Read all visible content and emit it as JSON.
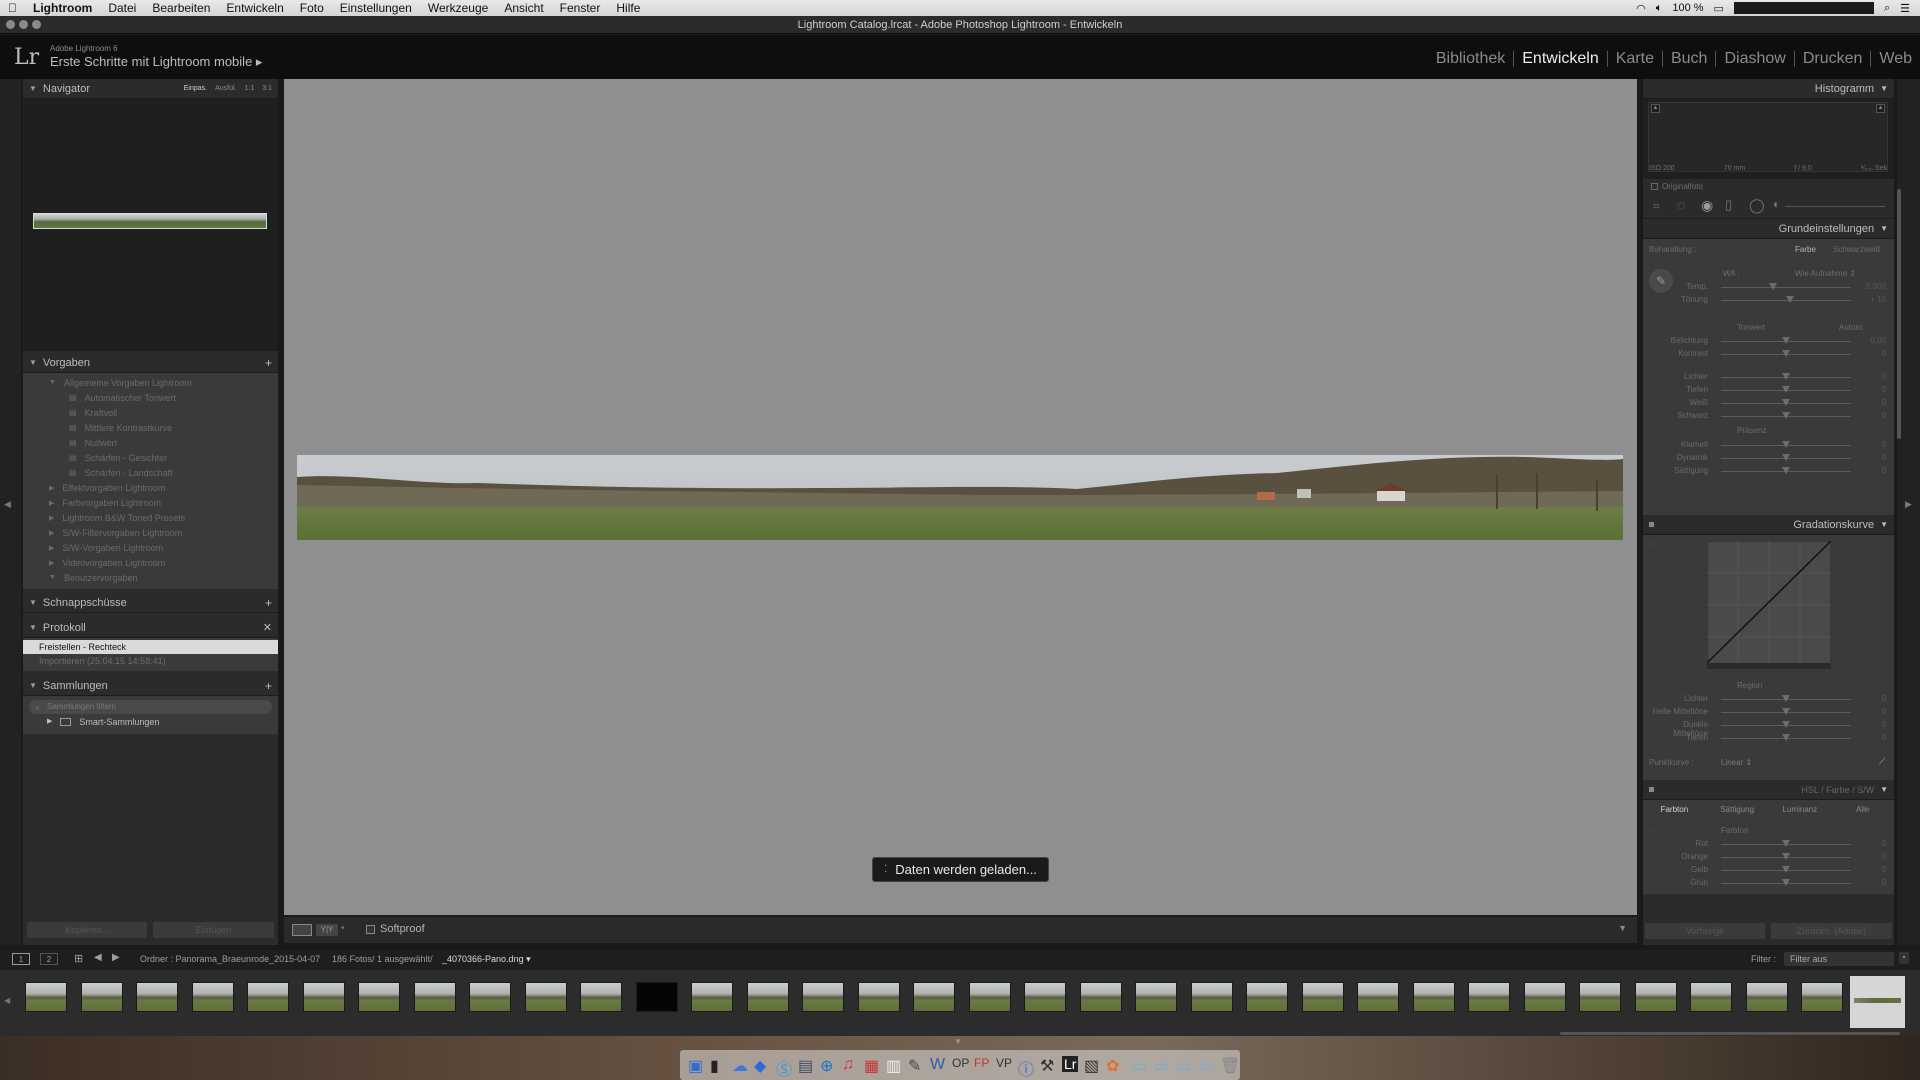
{
  "menubar": {
    "apple": "",
    "items": [
      "Lightroom",
      "Datei",
      "Bearbeiten",
      "Entwickeln",
      "Foto",
      "Einstellungen",
      "Werkzeuge",
      "Ansicht",
      "Fenster",
      "Hilfe"
    ],
    "battery": "100 %"
  },
  "window": {
    "title": "Lightroom Catalog.lrcat - Adobe Photoshop Lightroom - Entwickeln"
  },
  "identity": {
    "logo": "Lr",
    "version": "Adobe Lightroom 6",
    "plate": "Erste Schritte mit Lightroom mobile ▸"
  },
  "modules": [
    "Bibliothek",
    "Entwickeln",
    "Karte",
    "Buch",
    "Diashow",
    "Drucken",
    "Web"
  ],
  "navigator": {
    "title": "Navigator",
    "modes": [
      "Einpas.",
      "Ausfül.",
      "1:1",
      "3:1"
    ]
  },
  "presets": {
    "title": "Vorgaben",
    "items": [
      {
        "label": "Allgemeine Vorgaben Lightroom",
        "level": 1,
        "open": true
      },
      {
        "label": "Automatischer Tonwert",
        "level": 2
      },
      {
        "label": "Kraftvoll",
        "level": 2
      },
      {
        "label": "Mittlere Kontrastkurve",
        "level": 2
      },
      {
        "label": "Nullwert",
        "level": 2
      },
      {
        "label": "Schärfen - Gesichter",
        "level": 2
      },
      {
        "label": "Schärfen - Landschaft",
        "level": 2
      },
      {
        "label": "Effektvorgaben Lightroom",
        "level": 1
      },
      {
        "label": "Farbvorgaben Lightroom",
        "level": 1
      },
      {
        "label": "Lightroom B&W Toned Presets",
        "level": 1
      },
      {
        "label": "S/W-Filtervorgaben Lightroom",
        "level": 1
      },
      {
        "label": "S/W-Vorgaben Lightroom",
        "level": 1
      },
      {
        "label": "Videovorgaben Lightroom",
        "level": 1
      },
      {
        "label": "Benutzervorgaben",
        "level": 1,
        "open": true
      }
    ]
  },
  "snapshots": {
    "title": "Schnappschüsse"
  },
  "history": {
    "title": "Protokoll",
    "items": [
      "Freistellen - Rechteck",
      "Importieren (25.04.15 14:58:41)"
    ]
  },
  "collections": {
    "title": "Sammlungen",
    "search_placeholder": "Sammlungen filtern",
    "items": [
      "Smart-Sammlungen"
    ]
  },
  "left_buttons": {
    "copy": "Kopieren...",
    "paste": "Einfügen"
  },
  "toolbar": {
    "softproof": "Softproof"
  },
  "loading": {
    "text": "Daten werden geladen..."
  },
  "histogram": {
    "title": "Histogramm",
    "meta": [
      "ISO 200",
      "70 mm",
      "f / 9,0",
      "¹⁄₆₀₀ Sek."
    ],
    "original": "Originalfoto"
  },
  "basic": {
    "title": "Grundeinstellungen",
    "treatment": "Behandlung :",
    "color": "Farbe",
    "bw": "Schwarzweiß",
    "wb_label": "WA :",
    "wb_value": "Wie Aufnahme ⇕",
    "tone_header": "Tonwert",
    "auto": "Autom.",
    "presence": "Präsenz",
    "sliders": [
      {
        "label": "Temp.",
        "value": "5.000",
        "pos": 0.4
      },
      {
        "label": "Tönung",
        "value": "+ 10",
        "pos": 0.53
      },
      {
        "label": "Belichtung",
        "value": "0,00",
        "pos": 0.5
      },
      {
        "label": "Kontrast",
        "value": "0",
        "pos": 0.5
      },
      {
        "label": "Lichter",
        "value": "0",
        "pos": 0.5
      },
      {
        "label": "Tiefen",
        "value": "0",
        "pos": 0.5
      },
      {
        "label": "Weiß",
        "value": "0",
        "pos": 0.5
      },
      {
        "label": "Schwarz",
        "value": "0",
        "pos": 0.5
      },
      {
        "label": "Klarheit",
        "value": "0",
        "pos": 0.5
      },
      {
        "label": "Dynamik",
        "value": "0",
        "pos": 0.5
      },
      {
        "label": "Sättigung",
        "value": "0",
        "pos": 0.5
      }
    ]
  },
  "tone_curve": {
    "title": "Gradationskurve",
    "region": "Region",
    "sliders": [
      {
        "label": "Lichter",
        "value": "0"
      },
      {
        "label": "Helle Mitteltöne",
        "value": "0"
      },
      {
        "label": "Dunkle Mitteltöne",
        "value": "0"
      },
      {
        "label": "Tiefen",
        "value": "0"
      }
    ],
    "point_curve": "Punktkurve :",
    "point_curve_value": "Linear ⇕"
  },
  "hsl": {
    "title": "HSL / Farbe / S/W",
    "tabs": [
      "Farbton",
      "Sättigung",
      "Luminanz",
      "Alle"
    ],
    "subtitle": "Farbton",
    "sliders": [
      {
        "label": "Rot",
        "value": "0"
      },
      {
        "label": "Orange",
        "value": "0"
      },
      {
        "label": "Gelb",
        "value": "0"
      },
      {
        "label": "Grün",
        "value": "0"
      }
    ]
  },
  "right_buttons": {
    "prev": "Vorherige",
    "reset": "Zurückn. (Adobe)"
  },
  "filmbar": {
    "views": [
      "1",
      "2"
    ],
    "source": "Ordner : Panorama_Braeunrode_2015-04-07",
    "count": "186 Fotos/ 1 ausgewählt/",
    "file": "_4070366-Pano.dng ▾",
    "filter_label": "Filter :",
    "filter_value": "Filter aus"
  },
  "filmstrip": {
    "count": 34
  },
  "colors": {
    "accent": "#cfcfcf",
    "canvas": "#8f8f8f",
    "panel": "#2b2b2b"
  }
}
